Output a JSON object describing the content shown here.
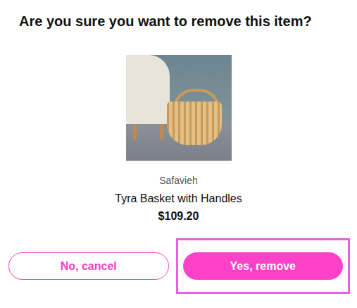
{
  "dialog": {
    "title": "Are you sure you want to remove this item?"
  },
  "product": {
    "brand": "Safavieh",
    "name": "Tyra Basket with Handles",
    "price": "$109.20"
  },
  "buttons": [
    {
      "label": "No, cancel",
      "kind": "secondary",
      "highlighted": false
    },
    {
      "label": "Yes, remove",
      "kind": "primary",
      "highlighted": true
    }
  ]
}
